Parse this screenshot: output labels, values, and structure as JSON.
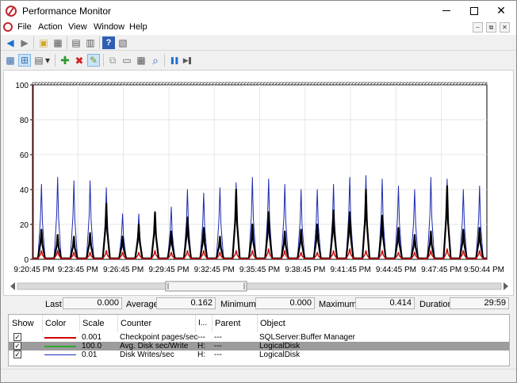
{
  "window": {
    "title": "Performance Monitor",
    "min_glyph": "",
    "max_glyph": "",
    "close_glyph": "✕"
  },
  "menu": [
    "File",
    "Action",
    "View",
    "Window",
    "Help"
  ],
  "mdi_controls": [
    "–",
    "⧉",
    "✕"
  ],
  "toolbar1": [
    {
      "name": "back-icon",
      "glyph": "◀",
      "color": "#1e6fd0"
    },
    {
      "name": "forward-icon",
      "glyph": "▶",
      "color": "#7a7a7a"
    },
    {
      "name": "up-folder-icon",
      "glyph": "▣",
      "color": "#d6a429"
    },
    {
      "name": "show-hide-tree-icon",
      "glyph": "▦",
      "color": "#5a5a5a"
    },
    {
      "name": "export-list-icon",
      "glyph": "▤",
      "color": "#5a5a5a"
    },
    {
      "name": "print-icon",
      "glyph": "▥",
      "color": "#5a5a5a"
    },
    {
      "name": "help-icon",
      "glyph": "?",
      "color": "#ffffff"
    },
    {
      "name": "properties-icon",
      "glyph": "▧",
      "color": "#5a5a5a"
    }
  ],
  "toolbar2": [
    {
      "name": "view-current-activity-icon",
      "glyph": "▩"
    },
    {
      "name": "view-log-data-icon",
      "glyph": "⊞"
    },
    {
      "name": "change-graph-type-icon",
      "glyph": "▤"
    },
    {
      "name": "graph-type-dropdown-icon",
      "glyph": "▾"
    },
    {
      "name": "add-counter-icon",
      "glyph": "✚",
      "color": "#2e9b2e"
    },
    {
      "name": "delete-counter-icon",
      "glyph": "✖",
      "color": "#d42020"
    },
    {
      "name": "highlight-icon",
      "glyph": "✎",
      "color": "#6a9a2e"
    },
    {
      "name": "copy-properties-icon",
      "glyph": "⧉"
    },
    {
      "name": "paste-counter-list-icon",
      "glyph": "▭"
    },
    {
      "name": "chart-properties-icon",
      "glyph": "▦"
    },
    {
      "name": "zoom-icon",
      "glyph": "⌕"
    },
    {
      "name": "freeze-display-icon",
      "glyph": "❚❚",
      "color": "#1e6fd0"
    },
    {
      "name": "update-data-icon",
      "glyph": "▶❚",
      "color": "#5a5a5a"
    }
  ],
  "chart_data": {
    "type": "line",
    "ylim": [
      0,
      100
    ],
    "y_ticks": [
      "0",
      "20",
      "40",
      "60",
      "80",
      "100"
    ],
    "x_ticks": [
      "9:20:45 PM",
      "9:23:45 PM",
      "9:26:45 PM",
      "9:29:45 PM",
      "9:32:45 PM",
      "9:35:45 PM",
      "9:38:45 PM",
      "9:41:45 PM",
      "9:44:45 PM",
      "9:47:45 PM",
      "9:50:44 PM"
    ],
    "grid": true,
    "spike_peaks": {
      "blue": [
        43,
        47,
        45,
        45,
        41,
        26,
        26,
        27,
        30,
        40,
        38,
        41,
        44,
        47,
        46,
        43,
        40,
        40,
        43,
        47,
        48,
        46,
        42,
        40,
        47,
        46,
        40,
        42
      ],
      "black": [
        17,
        14,
        13,
        15,
        32,
        13,
        20,
        27,
        16,
        24,
        18,
        13,
        40,
        20,
        27,
        16,
        17,
        20,
        28,
        27,
        40,
        25,
        18,
        14,
        16,
        42,
        17,
        18
      ],
      "red": [
        5,
        5,
        4,
        4,
        5,
        4,
        4,
        5,
        4,
        5,
        5,
        4,
        5,
        5,
        6,
        5,
        4,
        4,
        5,
        6,
        5,
        5,
        4,
        4,
        5,
        6,
        5,
        5
      ]
    },
    "series_colors": {
      "checkpoint": "#cc0000",
      "disk_write": "#000000",
      "disk_writes_sec": "#1c2bb0"
    }
  },
  "stats": {
    "last_label": "Last",
    "last_value": "0.000",
    "average_label": "Average",
    "average_value": "0.162",
    "minimum_label": "Minimum",
    "minimum_value": "0.000",
    "maximum_label": "Maximum",
    "maximum_value": "0.414",
    "duration_label": "Duration",
    "duration_value": "29:59"
  },
  "legend": {
    "headers": {
      "show": "Show",
      "color": "Color",
      "scale": "Scale",
      "counter": "Counter",
      "instance": "I...",
      "parent": "Parent",
      "object": "Object"
    },
    "rows": [
      {
        "checked": "✓",
        "color": "#cc0000",
        "scale": "0.001",
        "counter": "Checkpoint pages/sec",
        "instance": "---",
        "parent": "---",
        "object": "SQLServer:Buffer Manager"
      },
      {
        "checked": "✓",
        "color": "#000000",
        "scale": "100.0",
        "counter": "Avg. Disk sec/Write",
        "instance": "H:",
        "parent": "---",
        "object": "LogicalDisk"
      },
      {
        "checked": "✓",
        "color": "#1c2bb0",
        "scale": "0.01",
        "counter": "Disk Writes/sec",
        "instance": "H:",
        "parent": "---",
        "object": "LogicalDisk"
      }
    ]
  }
}
